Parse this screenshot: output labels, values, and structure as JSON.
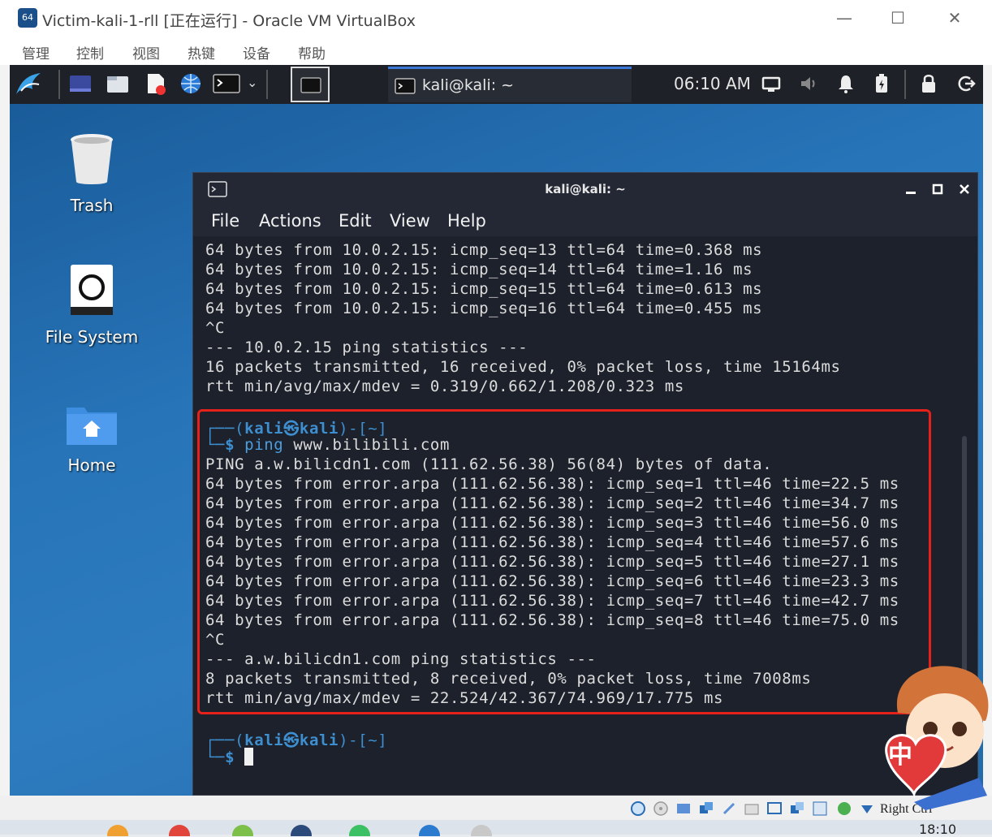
{
  "vbox": {
    "app_icon_text": "64",
    "title": "Victim-kali-1-rll [正在运行] - Oracle VM VirtualBox",
    "controls": {
      "minimize": "—",
      "maximize": "☐",
      "close": "✕"
    },
    "menu": [
      "管理",
      "控制",
      "视图",
      "热键",
      "设备",
      "帮助"
    ],
    "host_key": "Right Ctrl"
  },
  "kali_panel": {
    "active_task": "kali@kali: ~",
    "clock": "06:10 AM"
  },
  "desktop": {
    "icons": [
      "Trash",
      "File System",
      "Home"
    ]
  },
  "terminal": {
    "title": "kali@kali: ~",
    "menu": [
      "File",
      "Actions",
      "Edit",
      "View",
      "Help"
    ],
    "lines": [
      "64 bytes from 10.0.2.15: icmp_seq=13 ttl=64 time=0.368 ms",
      "64 bytes from 10.0.2.15: icmp_seq=14 ttl=64 time=1.16 ms",
      "64 bytes from 10.0.2.15: icmp_seq=15 ttl=64 time=0.613 ms",
      "64 bytes from 10.0.2.15: icmp_seq=16 ttl=64 time=0.455 ms",
      "^C",
      "--- 10.0.2.15 ping statistics ---",
      "16 packets transmitted, 16 received, 0% packet loss, time 15164ms",
      "rtt min/avg/max/mdev = 0.319/0.662/1.208/0.323 ms"
    ],
    "prompt": {
      "frame_top": "┌──(",
      "user": "kali㉿kali",
      "frame_close": ")-[~]",
      "frame_bottom": "└─",
      "symbol": "$"
    },
    "command": "ping",
    "command_arg": "www.bilibili.com",
    "ping_output": [
      "PING a.w.bilicdn1.com (111.62.56.38) 56(84) bytes of data.",
      "64 bytes from error.arpa (111.62.56.38): icmp_seq=1 ttl=46 time=22.5 ms",
      "64 bytes from error.arpa (111.62.56.38): icmp_seq=2 ttl=46 time=34.7 ms",
      "64 bytes from error.arpa (111.62.56.38): icmp_seq=3 ttl=46 time=56.0 ms",
      "64 bytes from error.arpa (111.62.56.38): icmp_seq=4 ttl=46 time=57.6 ms",
      "64 bytes from error.arpa (111.62.56.38): icmp_seq=5 ttl=46 time=27.1 ms",
      "64 bytes from error.arpa (111.62.56.38): icmp_seq=6 ttl=46 time=23.3 ms",
      "64 bytes from error.arpa (111.62.56.38): icmp_seq=7 ttl=46 time=42.7 ms",
      "64 bytes from error.arpa (111.62.56.38): icmp_seq=8 ttl=46 time=75.0 ms",
      "^C",
      "--- a.w.bilicdn1.com ping statistics ---",
      "8 packets transmitted, 8 received, 0% packet loss, time 7008ms",
      "rtt min/avg/max/mdev = 22.524/42.367/74.969/17.775 ms"
    ],
    "highlight_color": "#e4211b"
  },
  "host_taskbar": {
    "clock": "18:10"
  },
  "mascot": {
    "badge_text": "中"
  }
}
